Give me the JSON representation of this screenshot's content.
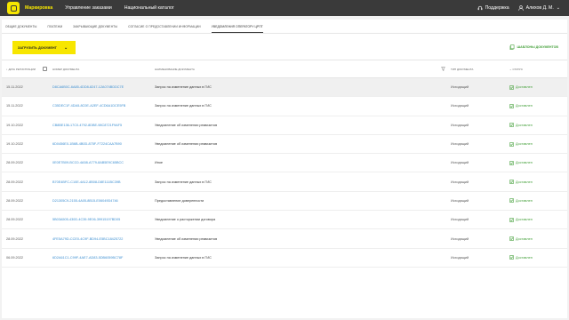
{
  "topbar": {
    "brand": "Маркировка",
    "nav": [
      "Управление заказами",
      "Национальный каталог"
    ],
    "support": "Поддержка",
    "user": "Алихов Д. М."
  },
  "tabs": [
    {
      "label": "Общие документы",
      "active": false
    },
    {
      "label": "Платежи",
      "active": false
    },
    {
      "label": "Закрывающие документы",
      "active": false
    },
    {
      "label": "Согласие о предоставлении информации",
      "active": false
    },
    {
      "label": "Уведомления оператору ЦРПТ",
      "active": true
    }
  ],
  "actions": {
    "upload": "ЗАГРУЗИТЬ ДОКУМЕНТ",
    "templates": "ШАБЛОНЫ ДОКУМЕНТОВ"
  },
  "table": {
    "headers": {
      "date": "Дата регистрации",
      "number": "Номер документа",
      "name": "Наименование документа",
      "type": "Тип документа",
      "status": "Статус"
    },
    "rows": [
      {
        "date": "15.11.2022",
        "number": "D8CA6B0C-6A85-4DD8-8247-12A074BDDC7E",
        "name": "Запрос на изменение данных в ГИС",
        "type": "Исходящий",
        "status": "Доставлен"
      },
      {
        "date": "15.11.2022",
        "number": "C35DEC1F-4DA5-8C0E-A2EF-4CD6A1DCE5FB",
        "name": "Запрос на изменение данных в ГИС",
        "type": "Исходящий",
        "status": "Доставлен"
      },
      {
        "date": "19.10.2022",
        "number": "CB8BE136-17C0-4792-8DBE-98C8721F9AF5",
        "name": "Уведомление об изменении реквизитов",
        "type": "Исходящий",
        "status": "Доставлен"
      },
      {
        "date": "19.10.2022",
        "number": "6D0456E0-1B6B-4B0D-875F-F7224CAA7B90",
        "name": "Уведомление об изменении реквизитов",
        "type": "Исходящий",
        "status": "Доставлен"
      },
      {
        "date": "28.09.2022",
        "number": "0E0E7B09-BCC0-4A58-A779-8AB5E9C65BCC",
        "name": "Иное",
        "type": "Исходящий",
        "status": "Доставлен"
      },
      {
        "date": "28.09.2022",
        "number": "B70E4BFC-C10E-4A12-8B08-D8E111BC39B",
        "name": "Запрос на изменение данных в ГИС",
        "type": "Исходящий",
        "status": "Доставлен"
      },
      {
        "date": "28.09.2022",
        "number": "D21305C9-2155-4A05-8B15-E06049D4746",
        "name": "Предоставление доверенности",
        "type": "Исходящий",
        "status": "Доставлен"
      },
      {
        "date": "28.09.2022",
        "number": "5B03A505-430D-4C39-9E06-39915197BD05",
        "name": "Уведомление о расторжении договора",
        "type": "Исходящий",
        "status": "Доставлен"
      },
      {
        "date": "28.09.2022",
        "number": "4FE5A79D-CCE0-4C9F-BD94-E5BC18425722",
        "name": "Уведомление об изменении реквизитов",
        "type": "Исходящий",
        "status": "Доставлен"
      },
      {
        "date": "06.09.2022",
        "number": "6D2A61C1-C99F-4AE7-AD83-5DB6059BC78F",
        "name": "Запрос на изменение данных в ГИС",
        "type": "Исходящий",
        "status": "Доставлен"
      }
    ]
  },
  "colors": {
    "accent": "#f7e600",
    "topbar": "#3a3a3a",
    "link": "#3d8fd1",
    "success": "#4aa340"
  }
}
